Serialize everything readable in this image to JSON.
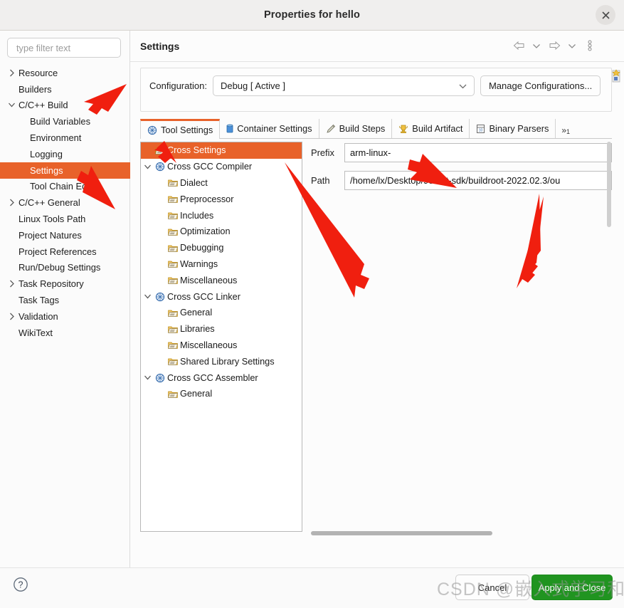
{
  "window": {
    "title": "Properties for hello",
    "close_icon": "close-icon"
  },
  "sidebar": {
    "filter_placeholder": "type filter text",
    "filter_value": "",
    "items": [
      {
        "label": "Resource",
        "indent": 0,
        "twisty": "collapsed",
        "selected": false
      },
      {
        "label": "Builders",
        "indent": 0,
        "twisty": "none",
        "selected": false
      },
      {
        "label": "C/C++ Build",
        "indent": 0,
        "twisty": "expanded",
        "selected": false
      },
      {
        "label": "Build Variables",
        "indent": 1,
        "twisty": "none",
        "selected": false
      },
      {
        "label": "Environment",
        "indent": 1,
        "twisty": "none",
        "selected": false
      },
      {
        "label": "Logging",
        "indent": 1,
        "twisty": "none",
        "selected": false
      },
      {
        "label": "Settings",
        "indent": 1,
        "twisty": "none",
        "selected": true
      },
      {
        "label": "Tool Chain Editor",
        "indent": 1,
        "twisty": "none",
        "selected": false
      },
      {
        "label": "C/C++ General",
        "indent": 0,
        "twisty": "collapsed",
        "selected": false
      },
      {
        "label": "Linux Tools Path",
        "indent": 0,
        "twisty": "none",
        "selected": false
      },
      {
        "label": "Project Natures",
        "indent": 0,
        "twisty": "none",
        "selected": false
      },
      {
        "label": "Project References",
        "indent": 0,
        "twisty": "none",
        "selected": false
      },
      {
        "label": "Run/Debug Settings",
        "indent": 0,
        "twisty": "none",
        "selected": false
      },
      {
        "label": "Task Repository",
        "indent": 0,
        "twisty": "collapsed",
        "selected": false
      },
      {
        "label": "Task Tags",
        "indent": 0,
        "twisty": "none",
        "selected": false
      },
      {
        "label": "Validation",
        "indent": 0,
        "twisty": "collapsed",
        "selected": false
      },
      {
        "label": "WikiText",
        "indent": 0,
        "twisty": "none",
        "selected": false
      }
    ]
  },
  "page": {
    "title": "Settings",
    "toolbar": {
      "back_icon": "back-arrow-icon",
      "back_menu_icon": "chevron-down-icon",
      "forward_icon": "forward-arrow-icon",
      "forward_menu_icon": "chevron-down-icon",
      "menu_icon": "vertical-dots-icon"
    },
    "edge_icon": "pin-icon"
  },
  "configuration": {
    "label": "Configuration:",
    "selected": "Debug [ Active ]",
    "options": [
      "Debug [ Active ]"
    ],
    "dropdown_icon": "chevron-down-icon",
    "manage_button": "Manage Configurations..."
  },
  "tabs": {
    "items": [
      {
        "label": "Tool Settings",
        "icon": "tool-settings-icon",
        "active": true
      },
      {
        "label": "Container Settings",
        "icon": "container-icon",
        "active": false
      },
      {
        "label": "Build Steps",
        "icon": "build-steps-icon",
        "active": false
      },
      {
        "label": "Build Artifact",
        "icon": "build-artifact-icon",
        "active": false
      },
      {
        "label": "Binary Parsers",
        "icon": "binary-parsers-icon",
        "active": false
      }
    ],
    "overflow_label": "»",
    "overflow_count": "1"
  },
  "options_tree": [
    {
      "label": "Cross Settings",
      "level": 1,
      "twisty": "none",
      "icon": "folder-icon",
      "selected": true
    },
    {
      "label": "Cross GCC Compiler",
      "level": 1,
      "twisty": "expanded",
      "icon": "tool-icon",
      "selected": false
    },
    {
      "label": "Dialect",
      "level": 2,
      "twisty": "none",
      "icon": "folder-icon",
      "selected": false
    },
    {
      "label": "Preprocessor",
      "level": 2,
      "twisty": "none",
      "icon": "folder-icon",
      "selected": false
    },
    {
      "label": "Includes",
      "level": 2,
      "twisty": "none",
      "icon": "folder-icon",
      "selected": false
    },
    {
      "label": "Optimization",
      "level": 2,
      "twisty": "none",
      "icon": "folder-icon",
      "selected": false
    },
    {
      "label": "Debugging",
      "level": 2,
      "twisty": "none",
      "icon": "folder-icon",
      "selected": false
    },
    {
      "label": "Warnings",
      "level": 2,
      "twisty": "none",
      "icon": "folder-icon",
      "selected": false
    },
    {
      "label": "Miscellaneous",
      "level": 2,
      "twisty": "none",
      "icon": "folder-icon",
      "selected": false
    },
    {
      "label": "Cross GCC Linker",
      "level": 1,
      "twisty": "expanded",
      "icon": "tool-icon",
      "selected": false
    },
    {
      "label": "General",
      "level": 2,
      "twisty": "none",
      "icon": "folder-icon",
      "selected": false
    },
    {
      "label": "Libraries",
      "level": 2,
      "twisty": "none",
      "icon": "folder-icon",
      "selected": false
    },
    {
      "label": "Miscellaneous",
      "level": 2,
      "twisty": "none",
      "icon": "folder-icon",
      "selected": false
    },
    {
      "label": "Shared Library Settings",
      "level": 2,
      "twisty": "none",
      "icon": "folder-icon",
      "selected": false
    },
    {
      "label": "Cross GCC Assembler",
      "level": 1,
      "twisty": "expanded",
      "icon": "tool-icon",
      "selected": false
    },
    {
      "label": "General",
      "level": 2,
      "twisty": "none",
      "icon": "folder-icon",
      "selected": false
    }
  ],
  "fields": [
    {
      "label": "Prefix",
      "value": "arm-linux-"
    },
    {
      "label": "Path",
      "value": "/home/lx/Desktop/980iot-sdk/buildroot-2022.02.3/ou"
    }
  ],
  "footer": {
    "help_icon": "help-icon",
    "cancel_label": "Cancel",
    "apply_label": "Apply and Close"
  },
  "watermark": "CSDN @嵌入式学习和实践",
  "colors": {
    "accent": "#e8622a",
    "apply_green": "#209420",
    "titlebar": "#f0efee"
  }
}
